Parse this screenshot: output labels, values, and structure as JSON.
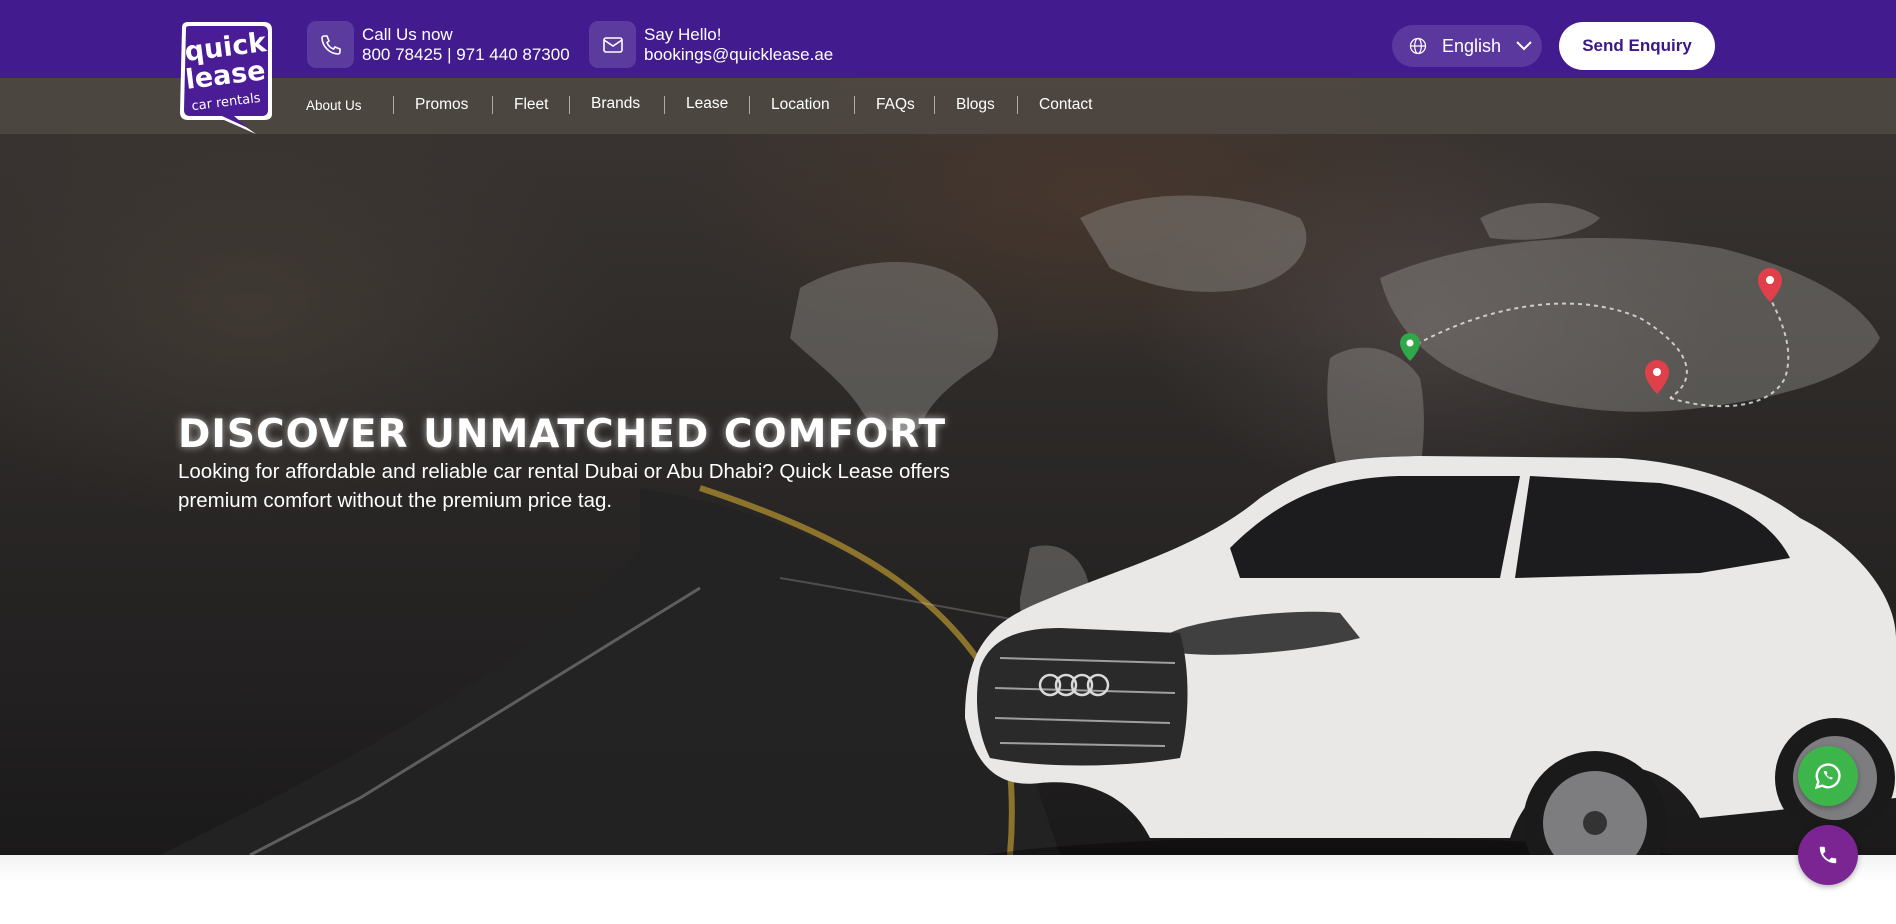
{
  "header": {
    "phone": {
      "label": "Call Us now",
      "value": "800 78425 | 971 440 87300",
      "icon": "phone-icon"
    },
    "email": {
      "label": "Say Hello!",
      "value": "bookings@quicklease.ae",
      "icon": "mail-icon"
    },
    "language": {
      "value": "English",
      "icon": "globe-icon"
    },
    "enquiry_label": "Send Enquiry"
  },
  "logo": {
    "line1": "quick",
    "line2": "lease",
    "line3": "car rentals"
  },
  "nav": {
    "items": [
      {
        "label": "About Us"
      },
      {
        "label": "Promos"
      },
      {
        "label": "Fleet"
      },
      {
        "label": "Brands"
      },
      {
        "label": "Lease"
      },
      {
        "label": "Location"
      },
      {
        "label": "FAQs"
      },
      {
        "label": "Blogs"
      },
      {
        "label": "Contact"
      }
    ]
  },
  "hero": {
    "title": "DISCOVER UNMATCHED COMFORT",
    "subtitle": "Looking for affordable and reliable car rental Dubai or Abu Dhabi? Quick Lease offers premium comfort without the premium price tag."
  },
  "floating": {
    "whatsapp_icon": "whatsapp-icon",
    "call_icon": "phone-icon"
  },
  "colors": {
    "brand": "#421b8f",
    "whatsapp": "#3cb54a",
    "call": "#7a2591",
    "pin_red": "#e0404a",
    "pin_green": "#2fa84a"
  }
}
